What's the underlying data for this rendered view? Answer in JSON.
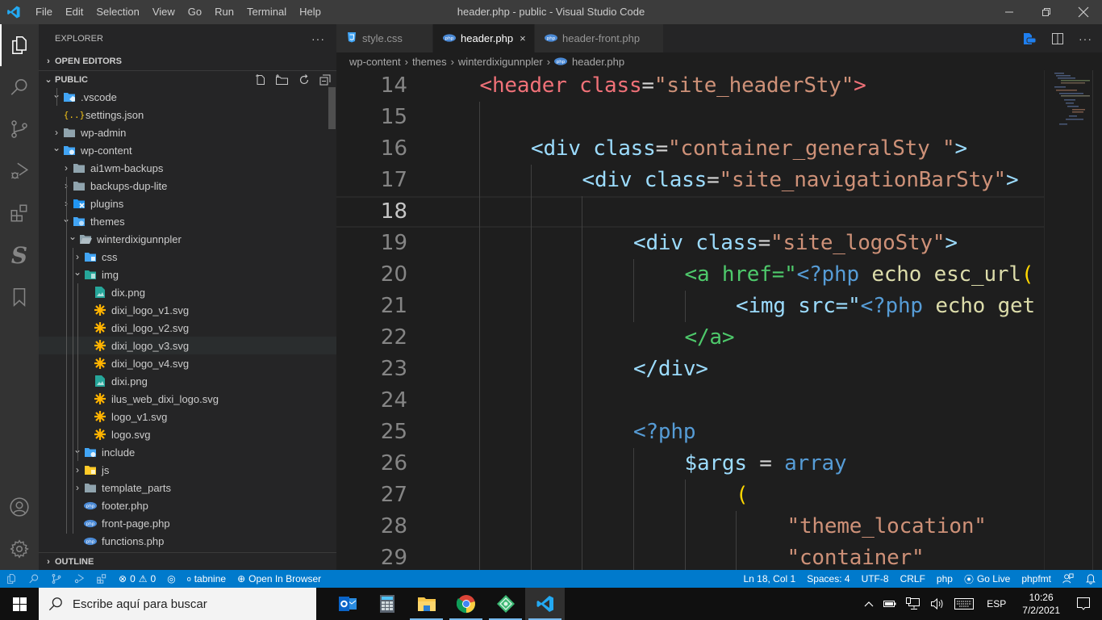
{
  "window": {
    "title": "header.php - public - Visual Studio Code",
    "menu": [
      "File",
      "Edit",
      "Selection",
      "View",
      "Go",
      "Run",
      "Terminal",
      "Help"
    ],
    "controls": [
      "minimize-icon",
      "restore-icon",
      "close-icon"
    ]
  },
  "activity_bar": {
    "top": [
      {
        "name": "explorer",
        "icon": "files-icon",
        "active": true
      },
      {
        "name": "search",
        "icon": "search-icon"
      },
      {
        "name": "source-control",
        "icon": "source-control-icon"
      },
      {
        "name": "run-debug",
        "icon": "run-debug-icon"
      },
      {
        "name": "extensions",
        "icon": "extensions-icon"
      },
      {
        "name": "snippets",
        "icon": "s-letter-icon"
      },
      {
        "name": "bookmarks",
        "icon": "bookmark-icon"
      }
    ],
    "bottom": [
      {
        "name": "accounts",
        "icon": "account-icon"
      },
      {
        "name": "manage",
        "icon": "gear-icon"
      }
    ]
  },
  "sidebar": {
    "title": "EXPLORER",
    "more_label": "···",
    "open_editors": "OPEN EDITORS",
    "folder": "PUBLIC",
    "outline": "OUTLINE",
    "tree": [
      {
        "label": ".vscode",
        "depth": 1,
        "type": "folder",
        "expanded": true,
        "icon": "vscode-folder"
      },
      {
        "label": "settings.json",
        "depth": 2,
        "type": "file",
        "icon": "json"
      },
      {
        "label": "wp-admin",
        "depth": 1,
        "type": "folder",
        "expanded": false,
        "icon": "folder"
      },
      {
        "label": "wp-content",
        "depth": 1,
        "type": "folder",
        "expanded": true,
        "icon": "wp-folder"
      },
      {
        "label": "ai1wm-backups",
        "depth": 2,
        "type": "folder",
        "expanded": false,
        "icon": "folder"
      },
      {
        "label": "backups-dup-lite",
        "depth": 2,
        "type": "folder",
        "expanded": false,
        "icon": "folder"
      },
      {
        "label": "plugins",
        "depth": 2,
        "type": "folder",
        "expanded": false,
        "icon": "plugin-folder"
      },
      {
        "label": "themes",
        "depth": 2,
        "type": "folder",
        "expanded": true,
        "icon": "theme-folder"
      },
      {
        "label": "winterdixigunnpler",
        "depth": 3,
        "type": "folder",
        "expanded": true,
        "icon": "folder-open"
      },
      {
        "label": "css",
        "depth": 4,
        "type": "folder",
        "expanded": false,
        "icon": "css-folder"
      },
      {
        "label": "img",
        "depth": 4,
        "type": "folder",
        "expanded": true,
        "icon": "img-folder"
      },
      {
        "label": "dix.png",
        "depth": 5,
        "type": "file",
        "icon": "image"
      },
      {
        "label": "dixi_logo_v1.svg",
        "depth": 5,
        "type": "file",
        "icon": "svg"
      },
      {
        "label": "dixi_logo_v2.svg",
        "depth": 5,
        "type": "file",
        "icon": "svg"
      },
      {
        "label": "dixi_logo_v3.svg",
        "depth": 5,
        "type": "file",
        "icon": "svg",
        "hover": true
      },
      {
        "label": "dixi_logo_v4.svg",
        "depth": 5,
        "type": "file",
        "icon": "svg"
      },
      {
        "label": "dixi.png",
        "depth": 5,
        "type": "file",
        "icon": "image"
      },
      {
        "label": "ilus_web_dixi_logo.svg",
        "depth": 5,
        "type": "file",
        "icon": "svg"
      },
      {
        "label": "logo_v1.svg",
        "depth": 5,
        "type": "file",
        "icon": "svg"
      },
      {
        "label": "logo.svg",
        "depth": 5,
        "type": "file",
        "icon": "svg"
      },
      {
        "label": "include",
        "depth": 4,
        "type": "folder",
        "expanded": true,
        "icon": "include-folder"
      },
      {
        "label": "js",
        "depth": 4,
        "type": "folder",
        "expanded": false,
        "icon": "js-folder"
      },
      {
        "label": "template_parts",
        "depth": 4,
        "type": "folder",
        "expanded": false,
        "icon": "folder"
      },
      {
        "label": "footer.php",
        "depth": 4,
        "type": "file",
        "icon": "php"
      },
      {
        "label": "front-page.php",
        "depth": 4,
        "type": "file",
        "icon": "php"
      },
      {
        "label": "functions.php",
        "depth": 4,
        "type": "file",
        "icon": "php"
      }
    ]
  },
  "tabs": [
    {
      "label": "style.css",
      "icon": "css",
      "active": false
    },
    {
      "label": "header.php",
      "icon": "php",
      "active": true,
      "close": "×"
    },
    {
      "label": "header-front.php",
      "icon": "php",
      "active": false
    }
  ],
  "breadcrumb": [
    "wp-content",
    "themes",
    "winterdixigunnpler",
    "header.php"
  ],
  "editor": {
    "current_line": 18,
    "lines": [
      {
        "n": "14",
        "indent": 1,
        "tokens": [
          [
            "t-tag",
            "<header "
          ],
          [
            "t-attr",
            "class"
          ],
          [
            "t-punc",
            "="
          ],
          [
            "t-str",
            "\"site_headerSty\""
          ],
          [
            "t-tag",
            ">"
          ]
        ]
      },
      {
        "n": "15",
        "indent": 0,
        "tokens": []
      },
      {
        "n": "16",
        "indent": 2,
        "tokens": [
          [
            "t-tag2",
            "<div "
          ],
          [
            "t-tag2",
            "class"
          ],
          [
            "t-punc",
            "="
          ],
          [
            "t-str",
            "\"container_generalSty \""
          ],
          [
            "t-tag2",
            ">"
          ]
        ]
      },
      {
        "n": "17",
        "indent": 3,
        "tokens": [
          [
            "t-tag2",
            "<div "
          ],
          [
            "t-tag2",
            "class"
          ],
          [
            "t-punc",
            "="
          ],
          [
            "t-str",
            "\"site_navigationBarSty\""
          ],
          [
            "t-tag2",
            ">"
          ]
        ]
      },
      {
        "n": "18",
        "indent": 0,
        "tokens": []
      },
      {
        "n": "19",
        "indent": 4,
        "tokens": [
          [
            "t-tag2",
            "<div "
          ],
          [
            "t-tag2",
            "class"
          ],
          [
            "t-punc",
            "="
          ],
          [
            "t-str",
            "\"site_logoSty\""
          ],
          [
            "t-tag2",
            ">"
          ]
        ]
      },
      {
        "n": "20",
        "indent": 5,
        "tokens": [
          [
            "t-green",
            "<a "
          ],
          [
            "t-green",
            "href"
          ],
          [
            "t-green",
            "=\""
          ],
          [
            "t-php",
            "<?php "
          ],
          [
            "t-fn",
            "echo esc_url"
          ],
          [
            "t-yel",
            "("
          ]
        ]
      },
      {
        "n": "21",
        "indent": 6,
        "tokens": [
          [
            "t-var",
            "<img "
          ],
          [
            "t-var",
            "src"
          ],
          [
            "t-var",
            "=\""
          ],
          [
            "t-php",
            "<?php "
          ],
          [
            "t-fn",
            "echo get"
          ]
        ]
      },
      {
        "n": "22",
        "indent": 5,
        "tokens": [
          [
            "t-green",
            "</a>"
          ]
        ]
      },
      {
        "n": "23",
        "indent": 4,
        "tokens": [
          [
            "t-tag2",
            "</div>"
          ]
        ]
      },
      {
        "n": "24",
        "indent": 0,
        "tokens": []
      },
      {
        "n": "25",
        "indent": 4,
        "tokens": [
          [
            "t-php",
            "<?php"
          ]
        ]
      },
      {
        "n": "26",
        "indent": 5,
        "tokens": [
          [
            "t-var",
            "$args "
          ],
          [
            "t-punc",
            "= "
          ],
          [
            "t-blue",
            "array"
          ]
        ]
      },
      {
        "n": "27",
        "indent": 6,
        "tokens": [
          [
            "t-yel",
            "("
          ]
        ]
      },
      {
        "n": "28",
        "indent": 7,
        "tokens": [
          [
            "t-str",
            "\"theme_location\""
          ]
        ]
      },
      {
        "n": "29",
        "indent": 7,
        "tokens": [
          [
            "t-str",
            "\"container\""
          ]
        ]
      }
    ]
  },
  "status_bar": {
    "left": [
      {
        "label": "",
        "icon": "files-icon"
      },
      {
        "label": "",
        "icon": "search-icon"
      },
      {
        "label": "",
        "icon": "source-control-icon"
      },
      {
        "label": "",
        "icon": "run-debug-icon"
      },
      {
        "label": "",
        "icon": "extensions-icon"
      },
      {
        "label": "0",
        "icon": "error-icon"
      },
      {
        "label": "0",
        "icon": "warning-icon"
      },
      {
        "label": "",
        "icon": "broadcast-icon"
      },
      {
        "label": "tabnine",
        "icon": "tabnine-icon"
      },
      {
        "label": "Open In Browser",
        "icon": "globe-icon"
      }
    ],
    "right": [
      {
        "label": "Ln 18, Col 1"
      },
      {
        "label": "Spaces: 4"
      },
      {
        "label": "UTF-8"
      },
      {
        "label": "CRLF"
      },
      {
        "label": "php"
      },
      {
        "label": "Go Live",
        "icon": "broadcast-icon"
      },
      {
        "label": "phpfmt"
      },
      {
        "label": "",
        "icon": "feedback-icon"
      },
      {
        "label": "",
        "icon": "bell-icon"
      }
    ]
  },
  "taskbar": {
    "search_placeholder": "Escribe aquí para buscar",
    "apps": [
      "outlook",
      "calculator",
      "file-explorer",
      "chrome",
      "gitkraken",
      "vscode"
    ],
    "language": "ESP",
    "time": "10:26",
    "date": "7/2/2021"
  },
  "colors": {
    "accent": "#007acc",
    "titlebar": "#3c3c3c",
    "sidebar": "#252526",
    "editor": "#1e1e1e"
  }
}
